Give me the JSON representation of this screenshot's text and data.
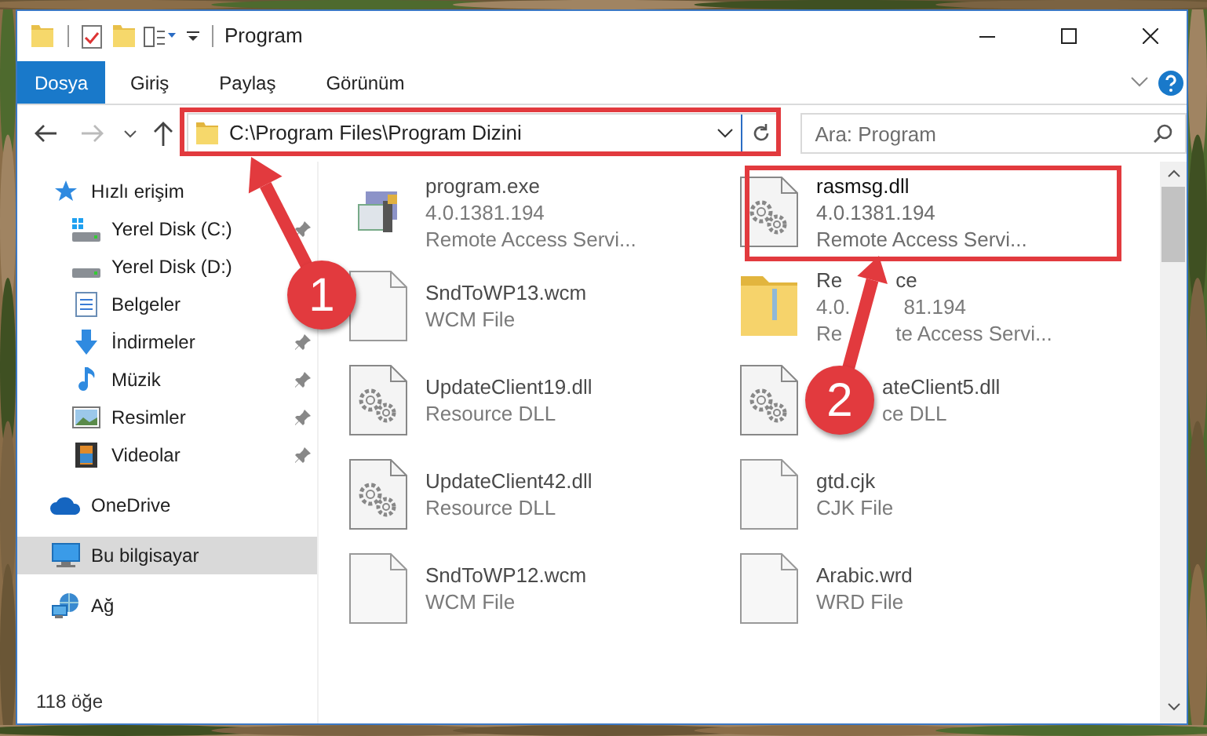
{
  "window": {
    "title": "Program"
  },
  "ribbon_tabs": [
    {
      "label": "Dosya",
      "selected": true
    },
    {
      "label": "Giriş",
      "selected": false
    },
    {
      "label": "Paylaş",
      "selected": false
    },
    {
      "label": "Görünüm",
      "selected": false
    }
  ],
  "address_bar": {
    "path": "C:\\Program Files\\Program Dizini"
  },
  "search": {
    "placeholder": "Ara: Program"
  },
  "sidebar": {
    "items": [
      {
        "label": "Hızlı erişim",
        "kind": "quick-access",
        "selected": false,
        "children": [
          {
            "label": "Yerel Disk (C:)",
            "kind": "drive-windows",
            "pinned": true,
            "selected": false
          },
          {
            "label": "Yerel Disk (D:)",
            "kind": "drive",
            "pinned": false,
            "selected": false
          },
          {
            "label": "Belgeler",
            "kind": "documents",
            "pinned": false,
            "selected": false
          },
          {
            "label": "İndirmeler",
            "kind": "downloads",
            "pinned": true,
            "selected": false
          },
          {
            "label": "Müzik",
            "kind": "music",
            "pinned": true,
            "selected": false
          },
          {
            "label": "Resimler",
            "kind": "pictures",
            "pinned": true,
            "selected": false
          },
          {
            "label": "Videolar",
            "kind": "videos",
            "pinned": true,
            "selected": false
          }
        ]
      },
      {
        "label": "OneDrive",
        "kind": "cloud",
        "selected": false
      },
      {
        "label": "Bu bilgisayar",
        "kind": "computer",
        "selected": true
      },
      {
        "label": "Ağ",
        "kind": "network",
        "selected": false
      }
    ]
  },
  "files": [
    {
      "name": "program.exe",
      "details": [
        "4.0.1381.194",
        "Remote Access Servi..."
      ],
      "kind": "app",
      "dimmed": true
    },
    {
      "name": "rasmsg.dll",
      "details": [
        "4.0.1381.194",
        "Remote Access Servi..."
      ],
      "kind": "dll",
      "dimmed": false
    },
    {
      "name": "SndToWP13.wcm",
      "details": [
        "WCM File"
      ],
      "kind": "blank",
      "dimmed": true
    },
    {
      "name": [
        "Re",
        "ce"
      ],
      "details": [
        [
          "4.0.",
          "81.194"
        ],
        [
          "Re",
          "te Access Servi..."
        ]
      ],
      "kind": "folder",
      "dimmed": true
    },
    {
      "name": "UpdateClient19.dll",
      "details": [
        "Resource DLL"
      ],
      "kind": "dll",
      "dimmed": true
    },
    {
      "name": "ateClient5.dll",
      "details": [
        "ce DLL"
      ],
      "kind": "dll",
      "dimmed": true
    },
    {
      "name": "UpdateClient42.dll",
      "details": [
        "Resource DLL"
      ],
      "kind": "dll",
      "dimmed": true
    },
    {
      "name": "gtd.cjk",
      "details": [
        "CJK File"
      ],
      "kind": "blank",
      "dimmed": true
    },
    {
      "name": "SndToWP12.wcm",
      "details": [
        "WCM File"
      ],
      "kind": "blank",
      "dimmed": true
    },
    {
      "name": "Arabic.wrd",
      "details": [
        "WRD File"
      ],
      "kind": "blank",
      "dimmed": true
    }
  ],
  "status_bar": {
    "item_count": "118 öğe"
  },
  "annotations": [
    {
      "kind": "box"
    },
    {
      "kind": "box"
    },
    {
      "kind": "arrow",
      "label": "1"
    },
    {
      "kind": "arrow",
      "label": "2"
    }
  ]
}
